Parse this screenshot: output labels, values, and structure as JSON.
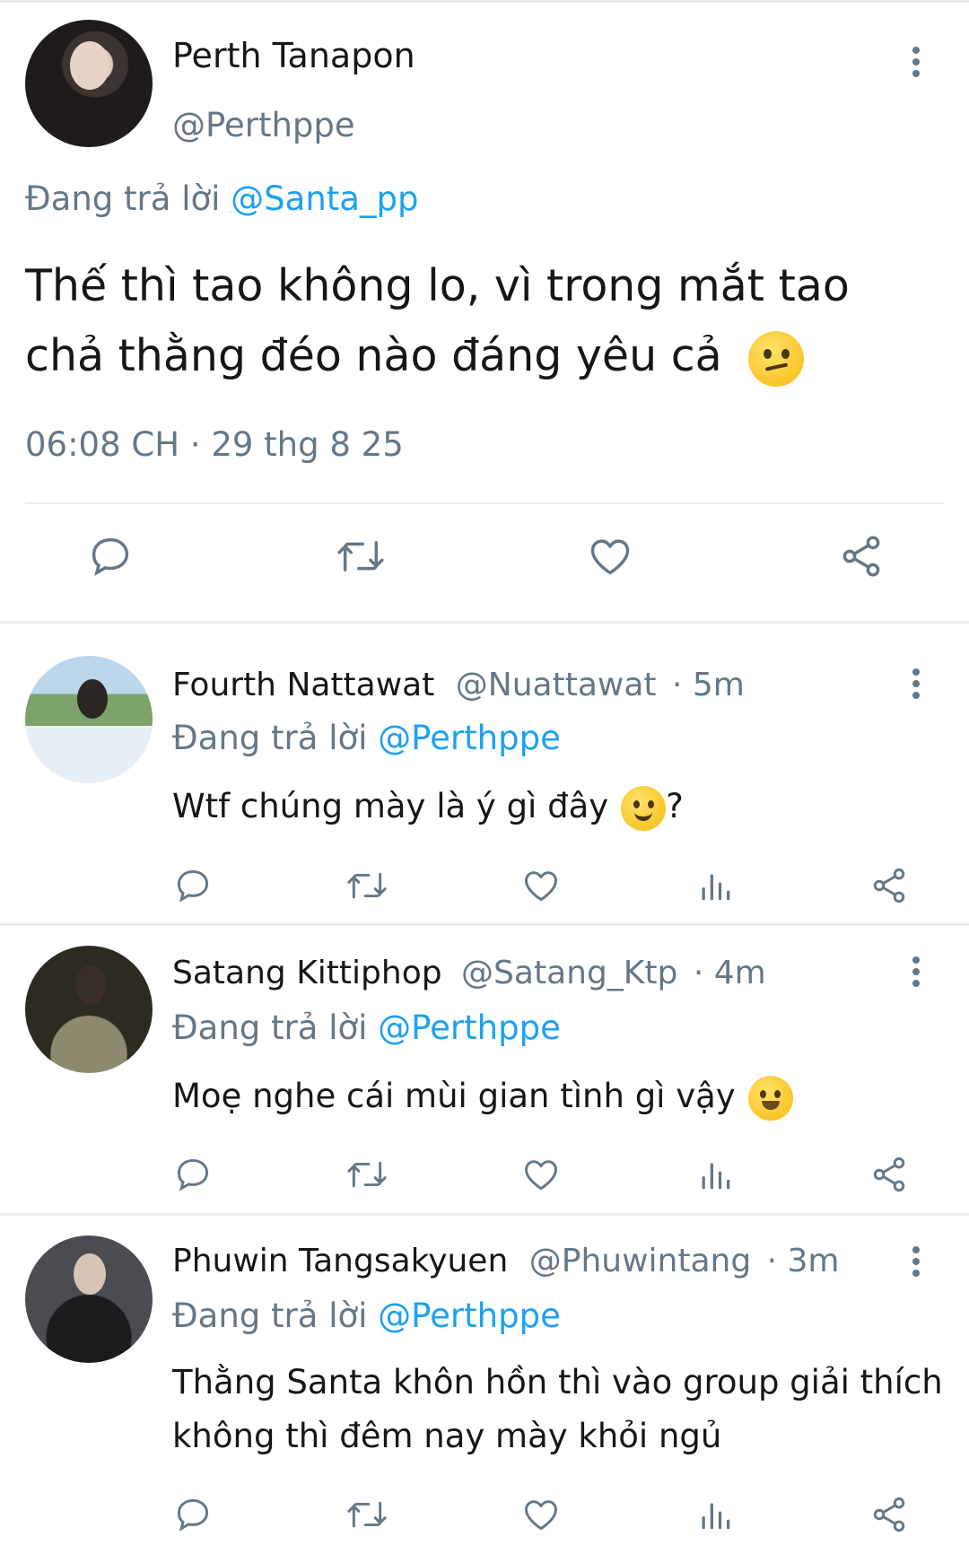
{
  "main_tweet": {
    "author_name": "Perth Tanapon",
    "author_handle": "@Perthppe",
    "replying_prefix": "Đang trả lời",
    "replying_to": "@Santa_pp",
    "text": "Thế thì tao không lo, vì trong mắt tao chả thằng đéo nào đáng yêu cả",
    "emoji": "confused-face-emoji",
    "timestamp": "06:08 CH · 29 thg 8 25",
    "actions": [
      "reply-icon",
      "retweet-icon",
      "like-icon",
      "share-icon"
    ]
  },
  "replies": [
    {
      "author_name": "Fourth Nattawat",
      "author_handle": "@Nuattawat",
      "time": "· 5m",
      "replying_prefix": "Đang trả lời",
      "replying_to": "@Perthppe",
      "text": "Wtf chúng mày là ý gì đây",
      "text_suffix": "?",
      "emoji": "slightly-smiling-face-emoji"
    },
    {
      "author_name": "Satang Kittiphop",
      "author_handle": "@Satang_Ktp",
      "time": "· 4m",
      "replying_prefix": "Đang trả lời",
      "replying_to": "@Perthppe",
      "text": "Moẹ nghe cái mùi gian tình gì vậy",
      "emoji": "grinning-face-emoji"
    },
    {
      "author_name": "Phuwin Tangsakyuen",
      "author_handle": "@Phuwintang",
      "time": "· 3m",
      "replying_prefix": "Đang trả lời",
      "replying_to": "@Perthppe",
      "text": "Thằng Santa khôn hồn thì vào group giải thích không thì đêm nay mày khỏi ngủ"
    }
  ],
  "colors": {
    "accent": "#1da1f2",
    "secondary_text": "#657786",
    "icon": "#657786",
    "divider": "#e6ecf0"
  }
}
